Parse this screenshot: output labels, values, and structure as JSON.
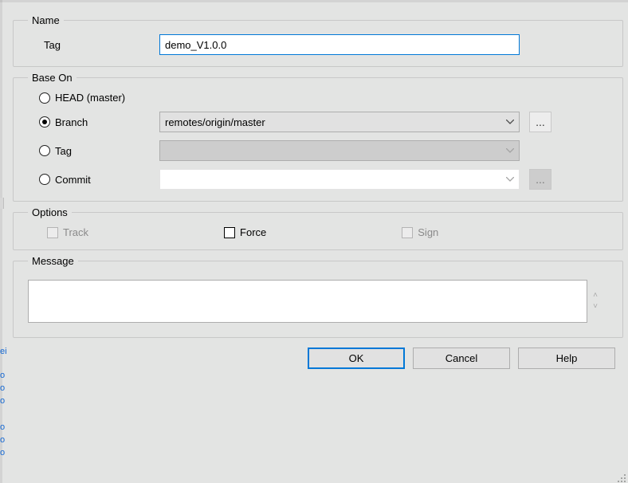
{
  "name_group": {
    "legend": "Name",
    "tag_label": "Tag",
    "tag_value": "demo_V1.0.0"
  },
  "base_group": {
    "legend": "Base On",
    "options": {
      "head": {
        "label": "HEAD (master)",
        "checked": false
      },
      "branch": {
        "label": "Branch",
        "checked": true,
        "value": "remotes/origin/master"
      },
      "tag": {
        "label": "Tag",
        "checked": false,
        "value": ""
      },
      "commit": {
        "label": "Commit",
        "checked": false,
        "value": ""
      }
    },
    "ellipsis": "..."
  },
  "options_group": {
    "legend": "Options",
    "track": {
      "label": "Track",
      "checked": false,
      "enabled": false
    },
    "force": {
      "label": "Force",
      "checked": false,
      "enabled": true
    },
    "sign": {
      "label": "Sign",
      "checked": false,
      "enabled": false
    }
  },
  "message_group": {
    "legend": "Message",
    "value": ""
  },
  "buttons": {
    "ok": "OK",
    "cancel": "Cancel",
    "help": "Help"
  }
}
